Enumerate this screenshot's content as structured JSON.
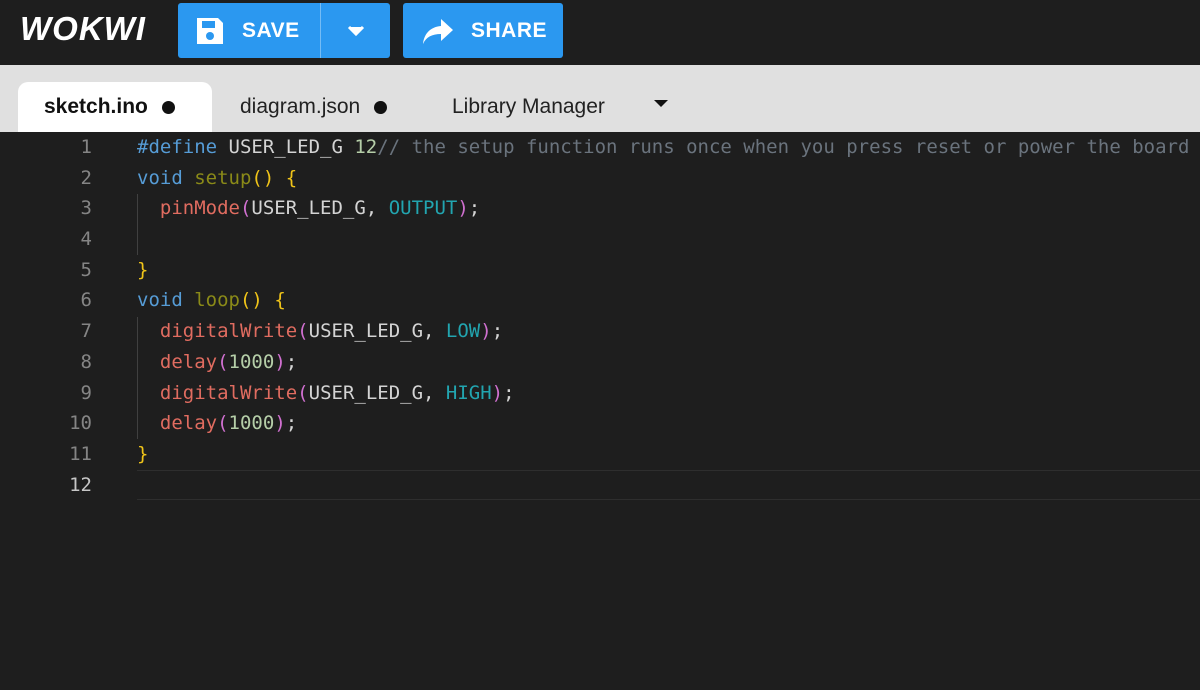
{
  "app": {
    "logo_text": "WOKWI"
  },
  "toolbar": {
    "save_label": "SAVE",
    "share_label": "SHARE",
    "accent_color": "#2b98f0"
  },
  "tabs": [
    {
      "label": "sketch.ino",
      "active": true,
      "modified": true
    },
    {
      "label": "diagram.json",
      "active": false,
      "modified": true
    },
    {
      "label": "Library Manager",
      "active": false,
      "modified": false
    }
  ],
  "editor": {
    "current_line": 12,
    "lines": [
      {
        "n": "1",
        "tokens": [
          [
            "k",
            "#define"
          ],
          [
            "id",
            " USER_LED_G "
          ],
          [
            "num",
            "12"
          ],
          [
            "cm",
            "// the setup function runs once when you press reset or power the board"
          ]
        ]
      },
      {
        "n": "2",
        "tokens": [
          [
            "k",
            "void"
          ],
          [
            "id",
            " "
          ],
          [
            "fn-def",
            "setup"
          ],
          [
            "p1",
            "()"
          ],
          [
            "id",
            " "
          ],
          [
            "p1",
            "{"
          ]
        ]
      },
      {
        "n": "3",
        "tokens": [
          [
            "id",
            "  "
          ],
          [
            "fn",
            "pinMode"
          ],
          [
            "p2",
            "("
          ],
          [
            "id",
            "USER_LED_G, "
          ],
          [
            "cst",
            "OUTPUT"
          ],
          [
            "p2",
            ")"
          ],
          [
            "id",
            ";"
          ]
        ]
      },
      {
        "n": "4",
        "tokens": [
          [
            "id",
            ""
          ]
        ]
      },
      {
        "n": "5",
        "tokens": [
          [
            "p1",
            "}"
          ]
        ]
      },
      {
        "n": "6",
        "tokens": [
          [
            "k",
            "void"
          ],
          [
            "id",
            " "
          ],
          [
            "fn-def",
            "loop"
          ],
          [
            "p1",
            "()"
          ],
          [
            "id",
            " "
          ],
          [
            "p1",
            "{"
          ]
        ]
      },
      {
        "n": "7",
        "tokens": [
          [
            "id",
            "  "
          ],
          [
            "fn",
            "digitalWrite"
          ],
          [
            "p2",
            "("
          ],
          [
            "id",
            "USER_LED_G, "
          ],
          [
            "cst",
            "LOW"
          ],
          [
            "p2",
            ")"
          ],
          [
            "id",
            ";"
          ]
        ]
      },
      {
        "n": "8",
        "tokens": [
          [
            "id",
            "  "
          ],
          [
            "fn",
            "delay"
          ],
          [
            "p2",
            "("
          ],
          [
            "num",
            "1000"
          ],
          [
            "p2",
            ")"
          ],
          [
            "id",
            ";"
          ]
        ]
      },
      {
        "n": "9",
        "tokens": [
          [
            "id",
            "  "
          ],
          [
            "fn",
            "digitalWrite"
          ],
          [
            "p2",
            "("
          ],
          [
            "id",
            "USER_LED_G, "
          ],
          [
            "cst",
            "HIGH"
          ],
          [
            "p2",
            ")"
          ],
          [
            "id",
            ";"
          ]
        ]
      },
      {
        "n": "10",
        "tokens": [
          [
            "id",
            "  "
          ],
          [
            "fn",
            "delay"
          ],
          [
            "p2",
            "("
          ],
          [
            "num",
            "1000"
          ],
          [
            "p2",
            ")"
          ],
          [
            "id",
            ";"
          ]
        ]
      },
      {
        "n": "11",
        "tokens": [
          [
            "p1",
            "}"
          ]
        ]
      },
      {
        "n": "12",
        "tokens": [
          [
            "id",
            ""
          ]
        ]
      }
    ]
  }
}
